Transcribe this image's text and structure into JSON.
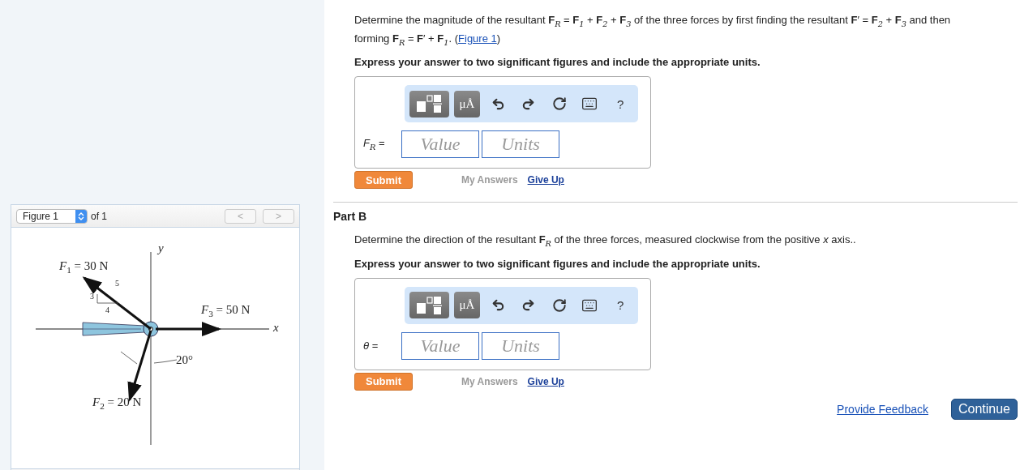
{
  "figure_panel": {
    "select": "Figure 1",
    "of_label": "of 1",
    "prev": "<",
    "next": ">",
    "labels": [
      {
        "kind": "force",
        "text": "*F*$_{1}$ = 30 N"
      },
      {
        "kind": "slope",
        "text": "5"
      },
      {
        "kind": "slope",
        "text": "3"
      },
      {
        "kind": "slope",
        "text": "4"
      },
      {
        "kind": "force",
        "text": "*F*$_{3}$ = 50 N"
      },
      {
        "kind": "axis",
        "text": "y"
      },
      {
        "kind": "axis",
        "text": "x"
      },
      {
        "kind": "angle",
        "text": "20°"
      },
      {
        "kind": "force",
        "text": "*F*$_{2}$ = 20 N"
      }
    ]
  },
  "parts": [
    {
      "question": "Determine the magnitude of the resultant **F**$_{R}$ = **F**$_{1}$ + **F**$_{2}$ + **F**$_{3}$ of the three forces by first finding the resultant **F**′ = **F**$_{2}$ + **F**$_{3}$ and then forming **F**$_{R}$ = **F**′ + **F**$_{1}$. (",
      "link": "Figure 1",
      "after": ")",
      "instruction": "Express your answer to two significant figures and include the appropriate units.",
      "toolbar": {
        "units_button": "μÅ",
        "help": "?"
      },
      "answer_label": "*F*$_{R}$ =",
      "value_placeholder": "Value",
      "units_placeholder": "Units",
      "submit": "Submit",
      "my_answers": "My Answers",
      "give_up": "Give Up"
    },
    {
      "heading": "Part B",
      "question": "Determine the direction of the resultant **F**$_{R}$ of the three forces, measured clockwise from the positive *x* axis..",
      "instruction": "Express your answer to two significant figures and include the appropriate units.",
      "toolbar": {
        "units_button": "μÅ",
        "help": "?"
      },
      "answer_label": "*θ* =",
      "value_placeholder": "Value",
      "units_placeholder": "Units",
      "submit": "Submit",
      "my_answers": "My Answers",
      "give_up": "Give Up"
    }
  ],
  "footer": {
    "feedback": "Provide Feedback",
    "continue": "Continue"
  }
}
